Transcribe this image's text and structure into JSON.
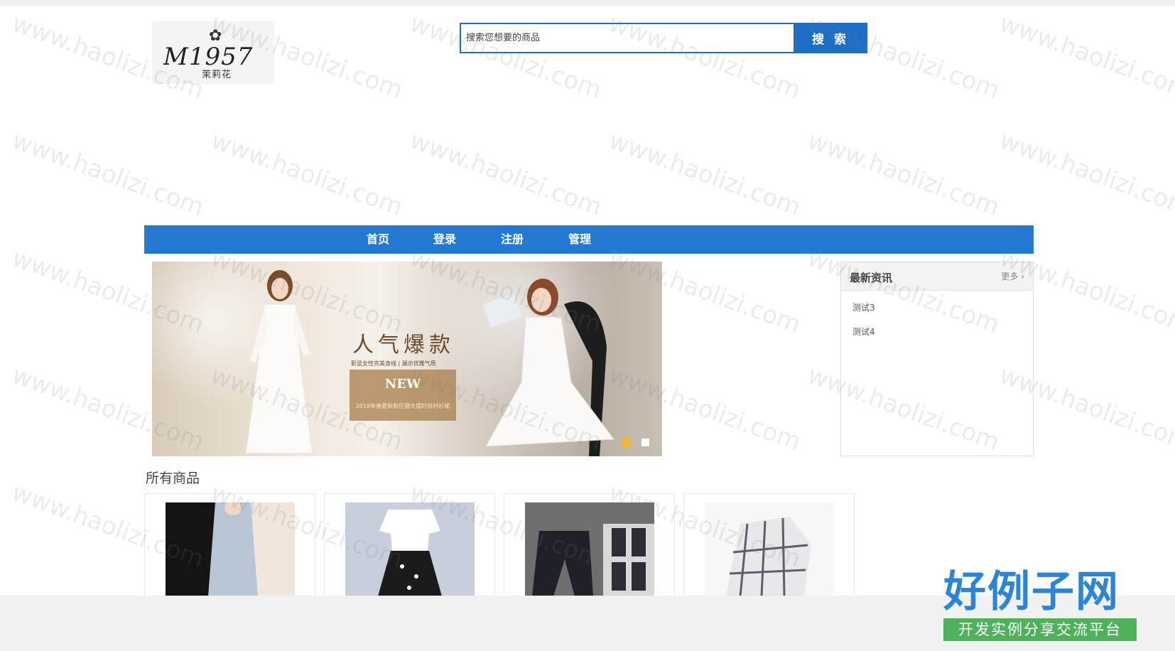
{
  "logo": {
    "mark": "M1957",
    "chinese": "茉莉花"
  },
  "search": {
    "placeholder": "搜索您想要的商品",
    "button_label": "搜 索"
  },
  "nav": {
    "items": [
      {
        "label": "首页"
      },
      {
        "label": "登录"
      },
      {
        "label": "注册"
      },
      {
        "label": "管理"
      }
    ]
  },
  "banner": {
    "title": "人气爆款",
    "subtitle": "彰显女性完美身线 | 展示优雅气质",
    "badge": "NEW",
    "badge_sub": "2018年春夏新款压褶大摆时尚衬衫裙",
    "active_slide": 1,
    "slide_count": 2,
    "colors": {
      "dot_active": "#f4b43a",
      "dot_idle": "#ffffff"
    }
  },
  "news": {
    "title": "最新资讯",
    "more_label": "更多 ›",
    "items": [
      {
        "label": "测试3"
      },
      {
        "label": "测试4"
      }
    ]
  },
  "products": {
    "section_title": "所有商品",
    "items": [
      {
        "image": "grey-sleeveless-dress"
      },
      {
        "image": "white-tee-floral-skirt"
      },
      {
        "image": "black-joggers"
      },
      {
        "image": "plaid-shirt"
      }
    ]
  },
  "watermark": "www.haolizi.com",
  "brand": {
    "name": "好例子网",
    "tagline": "开发实例分享交流平台"
  },
  "colors": {
    "primary": "#1e6ec8",
    "nav": "#2479d2",
    "brand_blue": "#2a84d8",
    "brand_green": "#4db25a"
  }
}
